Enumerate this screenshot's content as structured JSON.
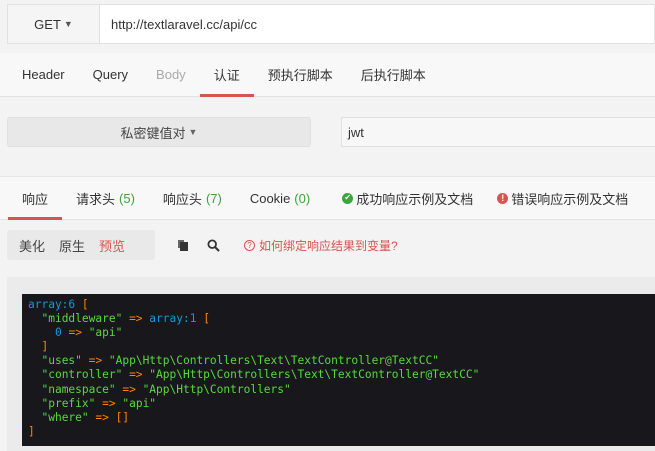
{
  "request": {
    "method": "GET",
    "url": "http://textlaravel.cc/api/cc"
  },
  "request_tabs": [
    {
      "label": "Header",
      "state": "normal"
    },
    {
      "label": "Query",
      "state": "normal"
    },
    {
      "label": "Body",
      "state": "disabled"
    },
    {
      "label": "认证",
      "state": "active"
    },
    {
      "label": "预执行脚本",
      "state": "normal"
    },
    {
      "label": "后执行脚本",
      "state": "normal"
    }
  ],
  "auth": {
    "type_label": "私密键值对",
    "value": "jwt"
  },
  "response_tabs": {
    "body": "响应",
    "req_headers": "请求头",
    "req_headers_count": "(5)",
    "resp_headers": "响应头",
    "resp_headers_count": "(7)",
    "cookie": "Cookie",
    "cookie_count": "(0)",
    "success_example": "成功响应示例及文档",
    "error_example": "错误响应示例及文档"
  },
  "view_modes": {
    "pretty": "美化",
    "raw": "原生",
    "preview": "预览",
    "active": "preview"
  },
  "bind_link": "如何绑定响应结果到变量?",
  "output": {
    "l1_kw": "array:6",
    "l1_br": "[",
    "l2_key": "\"middleware\"",
    "l2_op": "=>",
    "l2_kw": "array:1",
    "l2_br": "[",
    "l3_idx": "0",
    "l3_op": "=>",
    "l3_val": "\"api\"",
    "l4_br": "]",
    "l5_key": "\"uses\"",
    "l5_op": "=>",
    "l5_val": "\"App\\Http\\Controllers\\Text\\TextController@TextCC\"",
    "l6_key": "\"controller\"",
    "l6_op": "=>",
    "l6_val": "\"App\\Http\\Controllers\\Text\\TextController@TextCC\"",
    "l7_key": "\"namespace\"",
    "l7_op": "=>",
    "l7_val": "\"App\\Http\\Controllers\"",
    "l8_key": "\"prefix\"",
    "l8_op": "=>",
    "l8_val": "\"api\"",
    "l9_key": "\"where\"",
    "l9_op": "=>",
    "l9_val": "[]",
    "l10_br": "]"
  },
  "colors": {
    "accent": "#d9534f",
    "success": "#3aa63a",
    "dump_background": "#18171b",
    "dump_keyword": "#1299da",
    "dump_string": "#56db3a",
    "dump_operator": "#ff8400"
  },
  "icons": {
    "method_caret": "caret-down-icon",
    "auth_caret": "caret-down-icon",
    "success": "check-circle-icon",
    "error": "exclamation-circle-icon",
    "copy": "copy-icon",
    "search": "search-icon",
    "help": "question-circle-icon"
  }
}
